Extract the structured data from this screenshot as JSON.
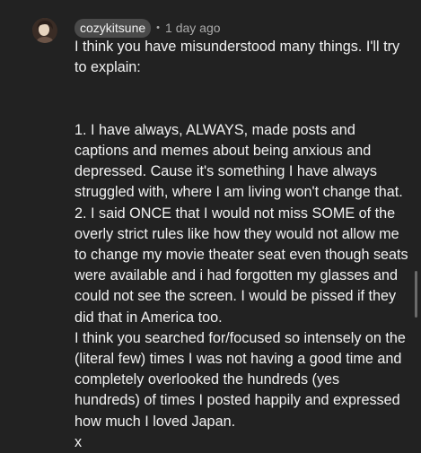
{
  "comment": {
    "author": "cozykitsune",
    "separator": "•",
    "timestamp": "1 day ago",
    "intro": "I think you have misunderstood many things. I'll try to explain:",
    "point1": "1. I have always, ALWAYS, made posts and captions and memes about being anxious and depressed. Cause it's something I have always struggled with, where I am living won't change that.",
    "point2": "2. I said ONCE that I would not miss SOME of the overly strict rules like how they would not allow me to change my movie theater seat even though seats were available and i had forgotten my glasses and could not see the screen. I would be pissed if they did that in America too.",
    "point3": "I think you searched for/focused so intensely on the (literal few) times I was not having a good time and completely overlooked the hundreds (yes hundreds) of times I posted happily and expressed how much I loved Japan.",
    "signoff": "x"
  },
  "icons": {
    "avatar": "avatar-photo"
  },
  "colors": {
    "background": "#222222",
    "text": "#f1f1f1",
    "secondary_text": "#aaaaaa",
    "username_chip": "#4a4a4a"
  }
}
